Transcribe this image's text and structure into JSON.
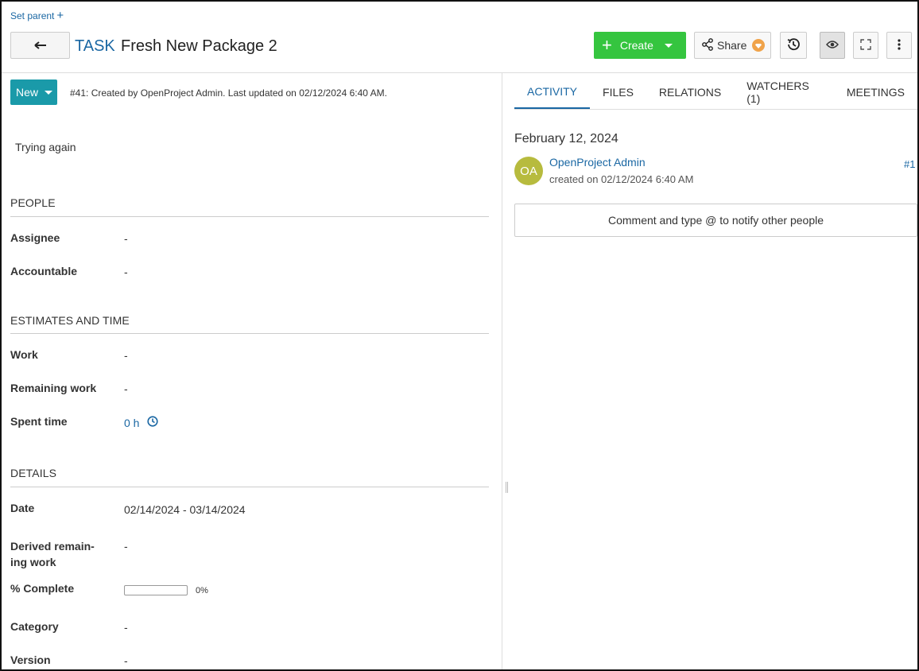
{
  "header": {
    "set_parent_label": "Set parent",
    "type_label": "TASK",
    "subject": "Fresh New Package 2",
    "create_label": "Create",
    "share_label": "Share"
  },
  "status": {
    "label": "New",
    "meta": "#41: Created by OpenProject Admin. Last updated on 02/12/2024 6:40 AM."
  },
  "description": "Trying again",
  "sections": {
    "people": {
      "title": "PEOPLE",
      "assignee_label": "Assignee",
      "assignee_value": "-",
      "accountable_label": "Accountable",
      "accountable_value": "-"
    },
    "estimates": {
      "title": "ESTIMATES AND TIME",
      "work_label": "Work",
      "work_value": "-",
      "remaining_label": "Remaining work",
      "remaining_value": "-",
      "spent_label": "Spent time",
      "spent_value": "0 h"
    },
    "details": {
      "title": "DETAILS",
      "date_label": "Date",
      "date_value": "02/14/2024 - 03/14/2024",
      "derived_label_line1": "Derived remain-",
      "derived_label_line2": "ing work",
      "derived_value": "-",
      "complete_label": "% Complete",
      "complete_percent": 0,
      "complete_text": "0%",
      "category_label": "Category",
      "category_value": "-",
      "version_label": "Version",
      "version_value": "-"
    }
  },
  "tabs": [
    {
      "label": "ACTIVITY",
      "active": true
    },
    {
      "label": "FILES",
      "active": false
    },
    {
      "label": "RELATIONS",
      "active": false
    },
    {
      "label": "WATCHERS (1)",
      "active": false
    },
    {
      "label": "MEETINGS",
      "active": false
    }
  ],
  "activity": {
    "day": "February 12, 2024",
    "avatar_initials": "OA",
    "author": "OpenProject Admin",
    "created": "created on 02/12/2024 6:40 AM",
    "number": "#1",
    "comment_placeholder": "Comment and type @ to notify other people"
  },
  "colors": {
    "accent": "#1a67a3",
    "status": "#1a9aa9",
    "create": "#35c53f",
    "avatar": "#b7bb3e",
    "badge": "#f0a34a"
  },
  "icons": [
    "back-arrow-icon",
    "plus-icon",
    "share-icon",
    "history-icon",
    "eye-icon",
    "fullscreen-icon",
    "more-vertical-icon",
    "clock-icon"
  ]
}
